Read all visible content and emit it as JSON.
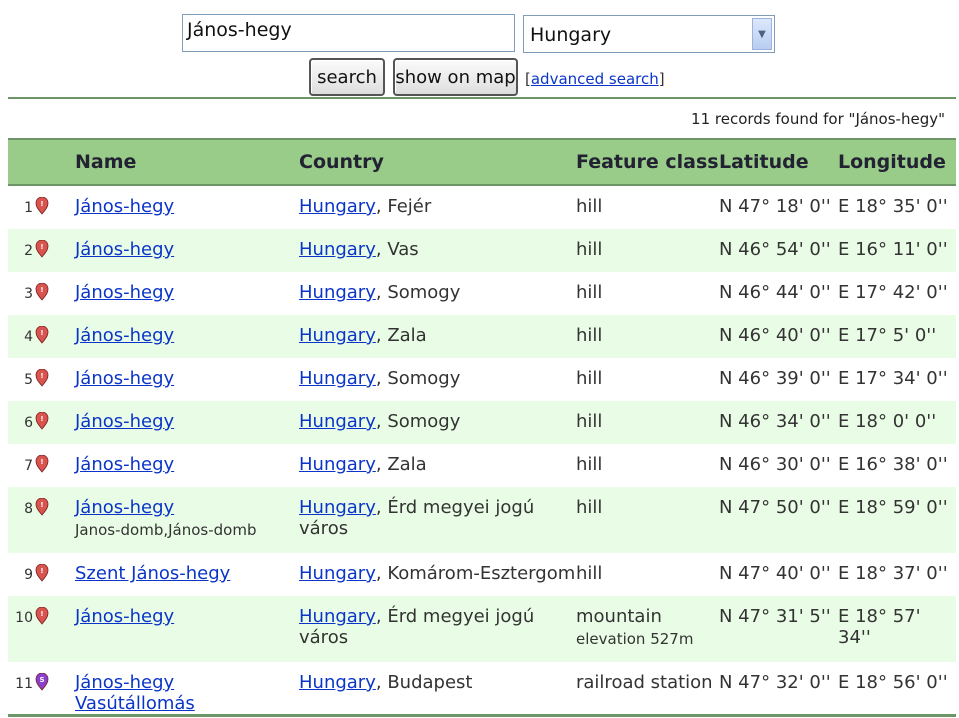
{
  "search": {
    "query": "János-hegy",
    "country": "Hungary"
  },
  "buttons": {
    "search": "search",
    "show_on_map": "show on map"
  },
  "advanced_search": {
    "open": "[",
    "label": "advanced search",
    "close": "]"
  },
  "records_text": "11 records found for \"János-hegy\"",
  "columns": [
    "Name",
    "Country",
    "Feature class",
    "Latitude",
    "Longitude"
  ],
  "colors": {
    "header_bg": "#99cc88",
    "alt_row": "#e9fde6",
    "link": "#0b35c9",
    "pin_red": "#d9534f",
    "pin_purple": "#8a3fd1"
  },
  "rows": [
    {
      "idx": "1",
      "pin": "hill-pin-icon",
      "name": "János-hegy",
      "country": "Hungary",
      "region": ", Fejér",
      "feature": "hill",
      "lat": "N 47° 18' 0''",
      "lon": "E 18° 35' 0''"
    },
    {
      "idx": "2",
      "pin": "hill-pin-icon",
      "name": "János-hegy",
      "country": "Hungary",
      "region": ", Vas",
      "feature": "hill",
      "lat": "N 46° 54' 0''",
      "lon": "E 16° 11' 0''"
    },
    {
      "idx": "3",
      "pin": "hill-pin-icon",
      "name": "János-hegy",
      "country": "Hungary",
      "region": ", Somogy",
      "feature": "hill",
      "lat": "N 46° 44' 0''",
      "lon": "E 17° 42' 0''"
    },
    {
      "idx": "4",
      "pin": "hill-pin-icon",
      "name": "János-hegy",
      "country": "Hungary",
      "region": ", Zala",
      "feature": "hill",
      "lat": "N 46° 40' 0''",
      "lon": "E 17° 5' 0''"
    },
    {
      "idx": "5",
      "pin": "hill-pin-icon",
      "name": "János-hegy",
      "country": "Hungary",
      "region": ", Somogy",
      "feature": "hill",
      "lat": "N 46° 39' 0''",
      "lon": "E 17° 34' 0''"
    },
    {
      "idx": "6",
      "pin": "hill-pin-icon",
      "name": "János-hegy",
      "country": "Hungary",
      "region": ", Somogy",
      "feature": "hill",
      "lat": "N 46° 34' 0''",
      "lon": "E 18° 0' 0''"
    },
    {
      "idx": "7",
      "pin": "hill-pin-icon",
      "name": "János-hegy",
      "country": "Hungary",
      "region": ", Zala",
      "feature": "hill",
      "lat": "N 46° 30' 0''",
      "lon": "E 16° 38' 0''"
    },
    {
      "idx": "8",
      "pin": "hill-pin-icon",
      "name": "János-hegy",
      "alt": "Janos-domb,János-domb",
      "country": "Hungary",
      "region": ", Érd megyei jogú város",
      "feature": "hill",
      "lat": "N 47° 50' 0''",
      "lon": "E 18° 59' 0''"
    },
    {
      "idx": "9",
      "pin": "hill-pin-icon",
      "name": "Szent János-hegy",
      "country": "Hungary",
      "region": ", Komárom-Esztergom",
      "feature": "hill",
      "lat": "N 47° 40' 0''",
      "lon": "E 18° 37' 0''"
    },
    {
      "idx": "10",
      "pin": "hill-pin-icon",
      "name": "János-hegy",
      "country": "Hungary",
      "region": ", Érd megyei jogú város",
      "feature": "mountain",
      "elevation": "elevation 527m",
      "lat": "N 47° 31' 5''",
      "lon": "E 18° 57' 34''"
    },
    {
      "idx": "11",
      "pin": "station-pin-icon",
      "name": "János-hegy Vasútállomás",
      "country": "Hungary",
      "region": ", Budapest",
      "feature": "railroad station",
      "lat": "N 47° 32' 0''",
      "lon": "E 18° 56' 0''"
    }
  ]
}
